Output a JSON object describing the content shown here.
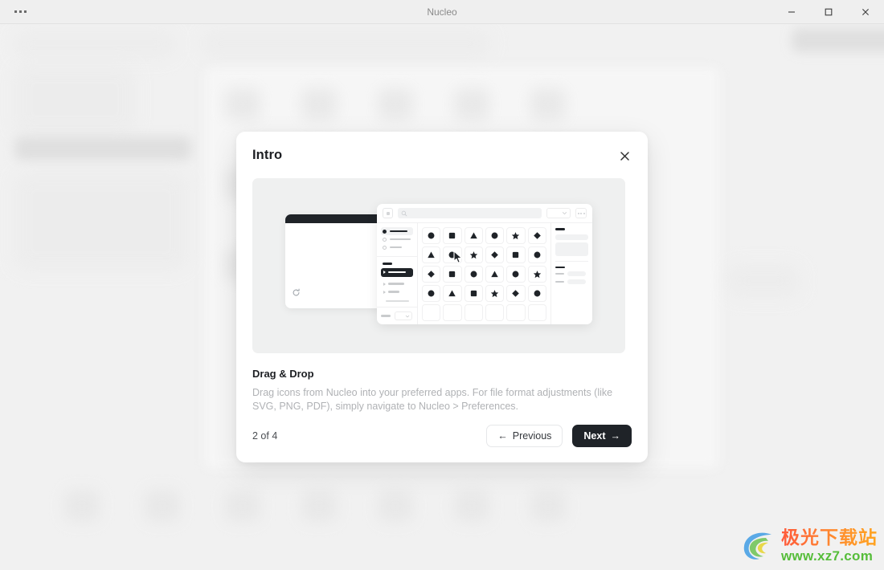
{
  "window": {
    "title": "Nucleo",
    "menu_icon": "ellipsis-icon",
    "minimize_icon": "minimize-icon",
    "maximize_icon": "maximize-icon",
    "close_icon": "close-icon"
  },
  "modal": {
    "title": "Intro",
    "close_label": "close-icon",
    "feature_title": "Drag & Drop",
    "feature_description": "Drag icons from Nucleo into your preferred apps. For file format adjustments (like SVG, PNG, PDF), simply navigate to Nucleo > Preferences.",
    "page_indicator": "2 of 4",
    "previous_label": "Previous",
    "previous_arrow": "←",
    "next_label": "Next",
    "next_arrow": "→"
  },
  "illustration": {
    "name": "drag-and-drop-illustration",
    "mini_window": {
      "refresh_icon": "refresh-icon"
    },
    "picker": {
      "search_icon": "search-icon",
      "grid_toggle_icon": "grid-toggle-icon",
      "dropdown_icon": "chevron-down-icon",
      "more_icon": "ellipsis-icon",
      "cursor_icon": "mouse-cursor-icon",
      "icon_grid": [
        [
          "circle",
          "square",
          "triangle",
          "circle",
          "star",
          "diamond"
        ],
        [
          "triangle",
          "circle",
          "star",
          "diamond",
          "square",
          "circle"
        ],
        [
          "diamond",
          "square",
          "circle",
          "triangle",
          "circle",
          "star"
        ],
        [
          "circle",
          "triangle",
          "square",
          "star",
          "diamond",
          "circle"
        ]
      ]
    }
  },
  "colors": {
    "accent_dark": "#1f2328",
    "modal_bg": "#ffffff",
    "stage_bg": "#eff0f0",
    "app_bg": "#f1f1f1",
    "muted_text": "#b0b2b5"
  },
  "watermark": {
    "title_cn": "极光下载站",
    "url": "www.xz7.com"
  }
}
